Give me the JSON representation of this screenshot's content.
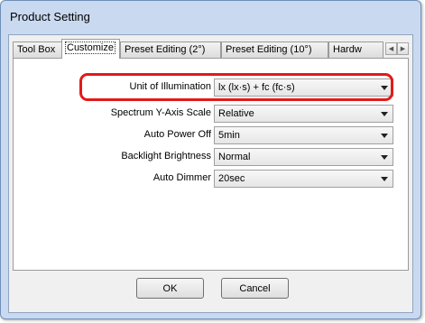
{
  "window": {
    "title": "Product Setting"
  },
  "tabs": [
    {
      "label": "Tool Box"
    },
    {
      "label": "Customize"
    },
    {
      "label": "Preset Editing (2°)"
    },
    {
      "label": "Preset Editing (10°)"
    },
    {
      "label": "Hardw"
    }
  ],
  "tab_scroll": {
    "left_icon": "scroll-left-icon",
    "right_icon": "scroll-right-icon"
  },
  "settings": [
    {
      "label": "Unit of Illumination",
      "value": "lx (lx·s) + fc (fc·s)"
    },
    {
      "label": "Spectrum Y-Axis Scale",
      "value": "Relative"
    },
    {
      "label": "Auto Power Off",
      "value": "5min"
    },
    {
      "label": "Backlight Brightness",
      "value": "Normal"
    },
    {
      "label": "Auto Dimmer",
      "value": "20sec"
    }
  ],
  "buttons": {
    "ok": "OK",
    "cancel": "Cancel"
  },
  "colors": {
    "highlight": "#e41919",
    "frame": "#c9daf0"
  }
}
